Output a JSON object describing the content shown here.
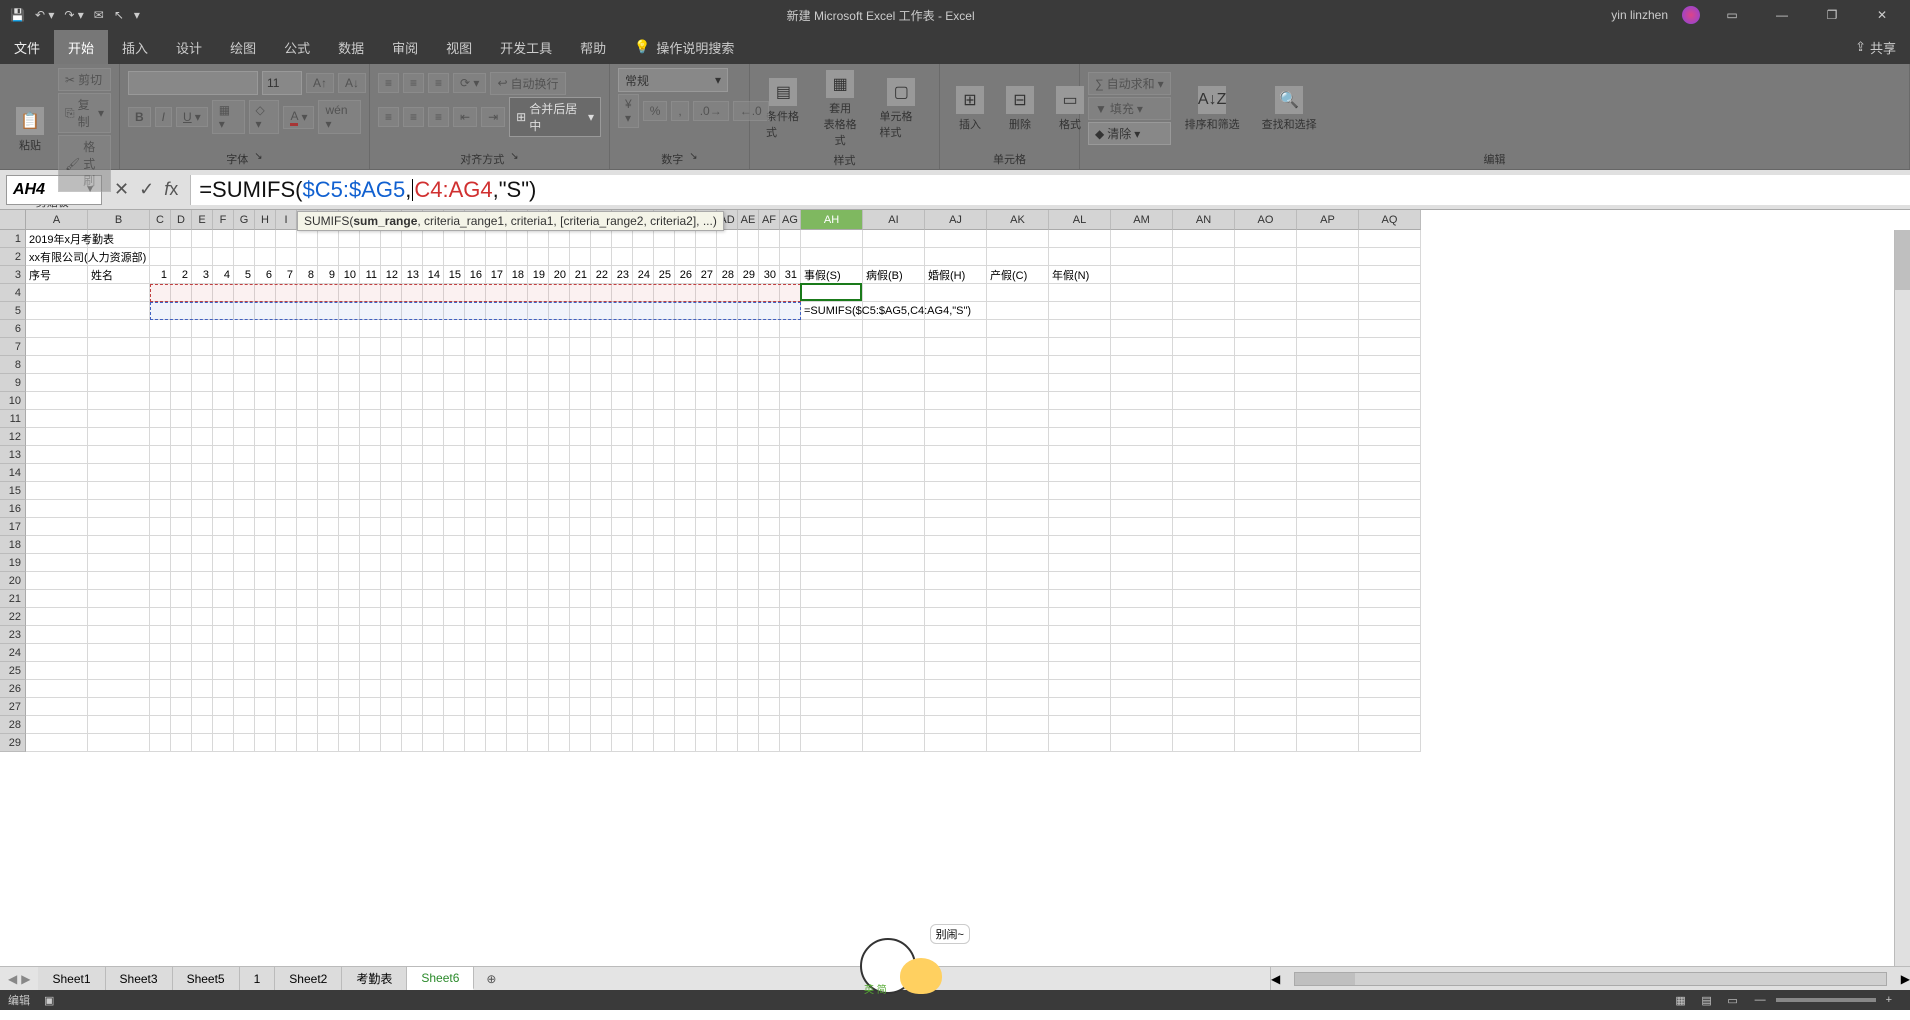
{
  "titlebar": {
    "title": "新建 Microsoft Excel 工作表 - Excel",
    "user": "yin linzhen"
  },
  "tabs": {
    "file": "文件",
    "items": [
      "开始",
      "插入",
      "设计",
      "绘图",
      "公式",
      "数据",
      "审阅",
      "视图",
      "开发工具",
      "帮助"
    ],
    "active": 0,
    "tell": "操作说明搜索",
    "share": "共享"
  },
  "ribbon": {
    "clipboard": {
      "paste": "粘贴",
      "cut": "剪切",
      "copy": "复制",
      "fmtpainter": "格式刷",
      "label": "剪贴板"
    },
    "font": {
      "name": "",
      "size": "11",
      "label": "字体"
    },
    "align": {
      "wrap": "自动换行",
      "merge": "合并后居中",
      "label": "对齐方式"
    },
    "number": {
      "format": "常规",
      "label": "数字"
    },
    "styles": {
      "cond": "条件格式",
      "table": "套用\n表格格式",
      "cell": "单元格样式",
      "label": "样式"
    },
    "cells": {
      "insert": "插入",
      "delete": "删除",
      "format": "格式",
      "label": "单元格"
    },
    "editing": {
      "sum": "自动求和",
      "fill": "填充",
      "clear": "清除",
      "sort": "排序和筛选",
      "find": "查找和选择",
      "label": "编辑"
    }
  },
  "namebox": "AH4",
  "formula": {
    "p1a": "=SUMIFS(",
    "p2": "$C5:$AG5",
    "comma1": ",",
    "p3": "C4:AG4",
    "p1b": ",\"S\")"
  },
  "tooltip": "SUMIFS(sum_range, criteria_range1, criteria1, [criteria_range2, criteria2], ...)",
  "sheet": {
    "cols_narrow": [
      "C",
      "D",
      "E",
      "F",
      "G",
      "H",
      "I",
      "J",
      "K",
      "L",
      "M",
      "N",
      "O",
      "P",
      "Q",
      "R",
      "S",
      "T",
      "U",
      "V",
      "W",
      "X",
      "Y",
      "Z",
      "AA",
      "AB",
      "AC",
      "AD",
      "AE",
      "AF",
      "AG"
    ],
    "cols_wide_after": [
      "AH",
      "AI",
      "AJ",
      "AK",
      "AL",
      "AM",
      "AN",
      "AO",
      "AP",
      "AQ"
    ],
    "row1": "2019年x月考勤表",
    "row2": "xx有限公司(人力资源部)",
    "row3_A": "序号",
    "row3_B": "姓名",
    "row3_days": [
      "1",
      "2",
      "3",
      "4",
      "5",
      "6",
      "7",
      "8",
      "9",
      "10",
      "11",
      "12",
      "13",
      "14",
      "15",
      "16",
      "17",
      "18",
      "19",
      "20",
      "21",
      "22",
      "23",
      "24",
      "25",
      "26",
      "27",
      "28",
      "29",
      "30",
      "31"
    ],
    "row3_AH": "事假(S)",
    "row3_AI": "病假(B)",
    "row3_AJ": "婚假(H)",
    "row3_AK": "产假(C)",
    "row3_AL": "年假(N)",
    "row5_formula": "=SUMIFS($C5:$AG5,C4:AG4,\"S\")"
  },
  "sheettabs": {
    "items": [
      "Sheet1",
      "Sheet3",
      "Sheet5",
      "1",
      "Sheet2",
      "考勤表",
      "Sheet6"
    ],
    "active": 6
  },
  "status": {
    "mode": "编辑"
  },
  "sticker": {
    "text": "别闹~",
    "tag": "英 简"
  }
}
